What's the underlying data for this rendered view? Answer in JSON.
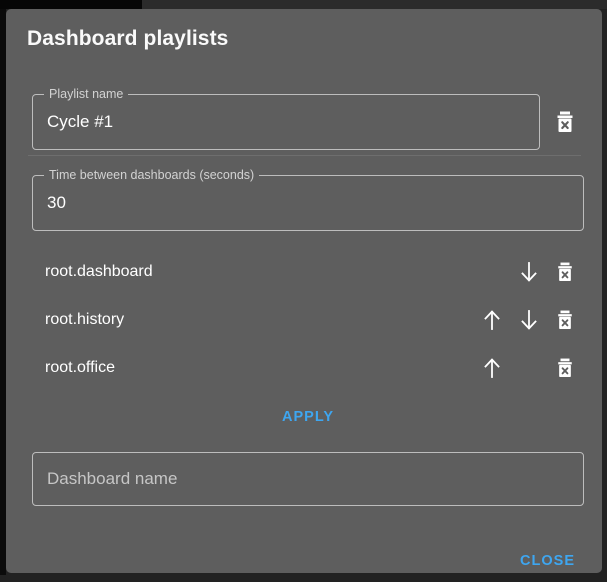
{
  "dialog": {
    "title": "Dashboard playlists"
  },
  "playlist_name": {
    "legend": "Playlist name",
    "value": "Cycle #1",
    "delete_icon": "trash-delete-icon"
  },
  "time_between": {
    "legend": "Time between dashboards (seconds)",
    "value": "30"
  },
  "dashboard_list": {
    "rows": [
      {
        "label": "root.dashboard",
        "has_up": false,
        "has_down": true,
        "up_icon": "arrow-up-icon",
        "down_icon": "arrow-down-icon",
        "trash_icon": "trash-delete-icon"
      },
      {
        "label": "root.history",
        "has_up": true,
        "has_down": true,
        "up_icon": "arrow-up-icon",
        "down_icon": "arrow-down-icon",
        "trash_icon": "trash-delete-icon"
      },
      {
        "label": "root.office",
        "has_up": true,
        "has_down": false,
        "up_icon": "arrow-up-icon",
        "down_icon": "arrow-down-icon",
        "trash_icon": "trash-delete-icon"
      }
    ]
  },
  "apply": {
    "label": "APPLY"
  },
  "dashboard_name": {
    "placeholder": "Dashboard name",
    "value": ""
  },
  "close": {
    "label": "CLOSE"
  },
  "colors": {
    "dialog_background": "#5e5e5e",
    "page_background": "#222222",
    "accent": "#3ea6f0",
    "text": "#ffffff",
    "muted_text": "#c6c6c6",
    "field_border": "#bdbdbd"
  }
}
